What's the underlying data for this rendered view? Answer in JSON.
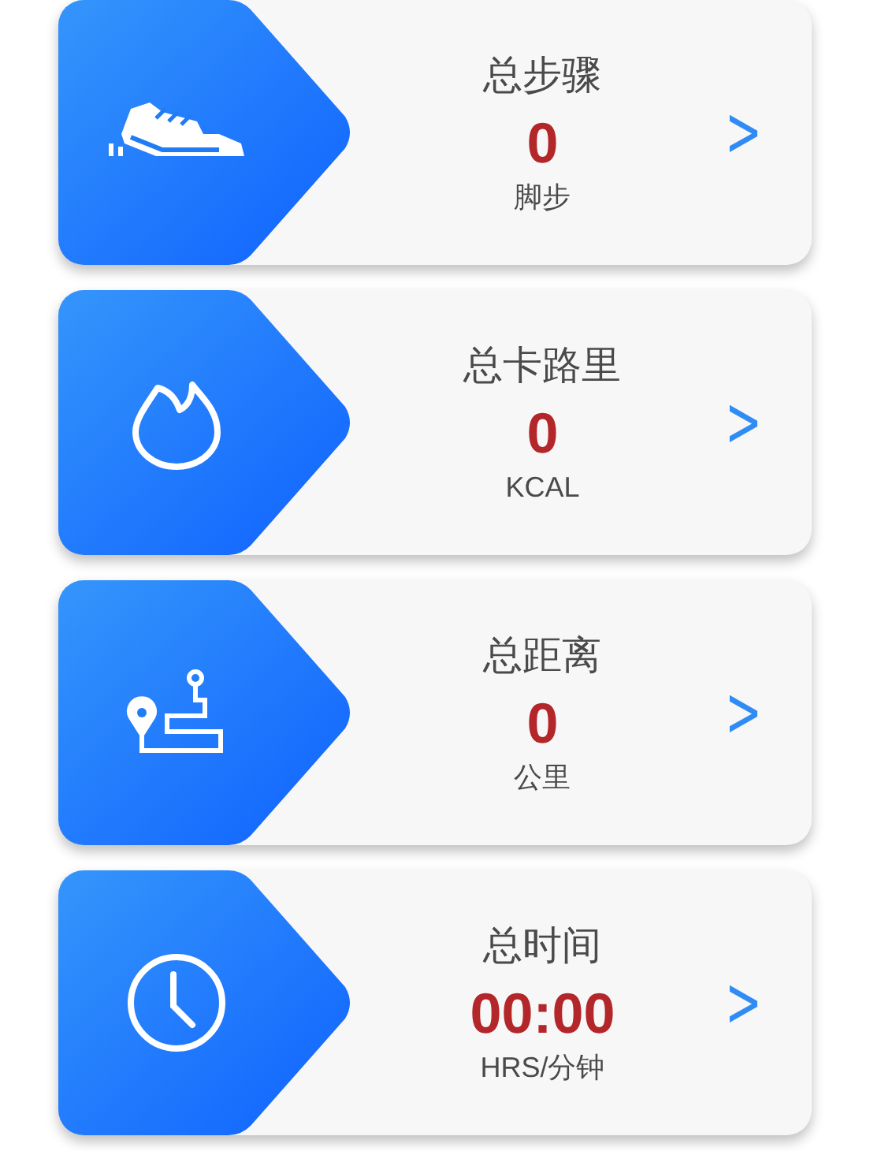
{
  "cards": [
    {
      "kind": "steps",
      "title": "总步骤",
      "value": "0",
      "unit": "脚步",
      "chevron": ">"
    },
    {
      "kind": "calories",
      "title": "总卡路里",
      "value": "0",
      "unit": "KCAL",
      "chevron": ">"
    },
    {
      "kind": "distance",
      "title": "总距离",
      "value": "0",
      "unit": "公里",
      "chevron": ">"
    },
    {
      "kind": "time",
      "title": "总时间",
      "value": "00:00",
      "unit": "HRS/分钟",
      "chevron": ">"
    }
  ]
}
